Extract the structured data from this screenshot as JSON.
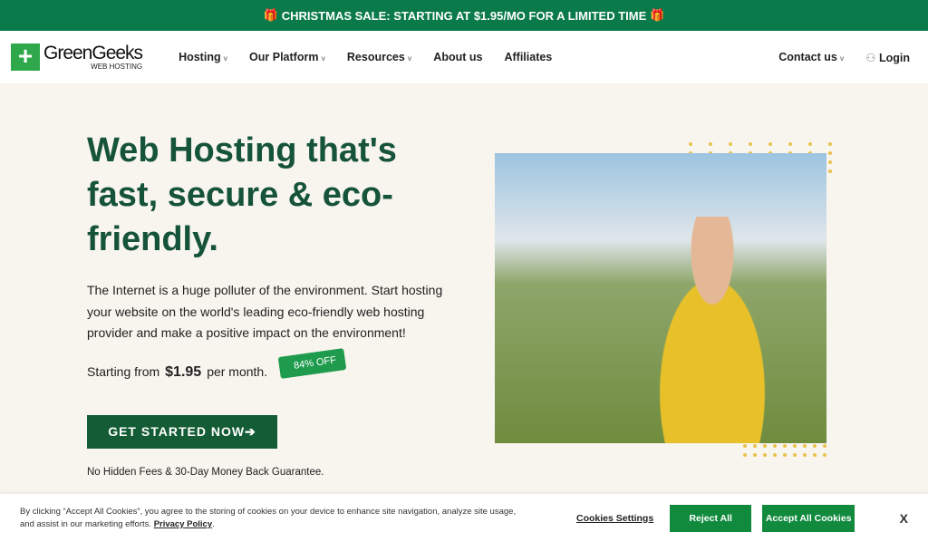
{
  "promo": {
    "icon": "gift-icon",
    "text": "CHRISTMAS SALE: STARTING AT $1.95/MO FOR A LIMITED TIME"
  },
  "nav": {
    "logo": "GreenGeeks",
    "logo_sub": "WEB HOSTING",
    "items": [
      "Hosting",
      "Our Platform",
      "Resources",
      "About us",
      "Affiliates"
    ],
    "contact": "Contact us",
    "login": "Login"
  },
  "hero": {
    "title": "Web Hosting that's fast, secure & eco-friendly.",
    "description": "The Internet is a huge polluter of the environment. Start hosting your website on the world's leading eco-friendly web hosting provider and make a positive impact on the environment!",
    "price_prefix": "Starting from",
    "price": "$1.95",
    "price_suffix": "per month.",
    "discount": "84% OFF",
    "cta": "GET STARTED NOW➔",
    "guarantee": "No Hidden Fees & 30-Day Money Back Guarantee."
  },
  "cookie": {
    "text": "By clicking “Accept All Cookies”, you agree to the storing of cookies on your device to enhance site navigation, analyze site usage, and assist in our marketing efforts.",
    "privacy": "Privacy Policy",
    "settings": "Cookies Settings",
    "reject": "Reject All",
    "accept": "Accept All Cookies",
    "close": "X"
  },
  "colors": {
    "brand": "#0b7a4a",
    "heading": "#15533a",
    "cta": "#135c35",
    "cookie_btn": "#118a3e"
  }
}
